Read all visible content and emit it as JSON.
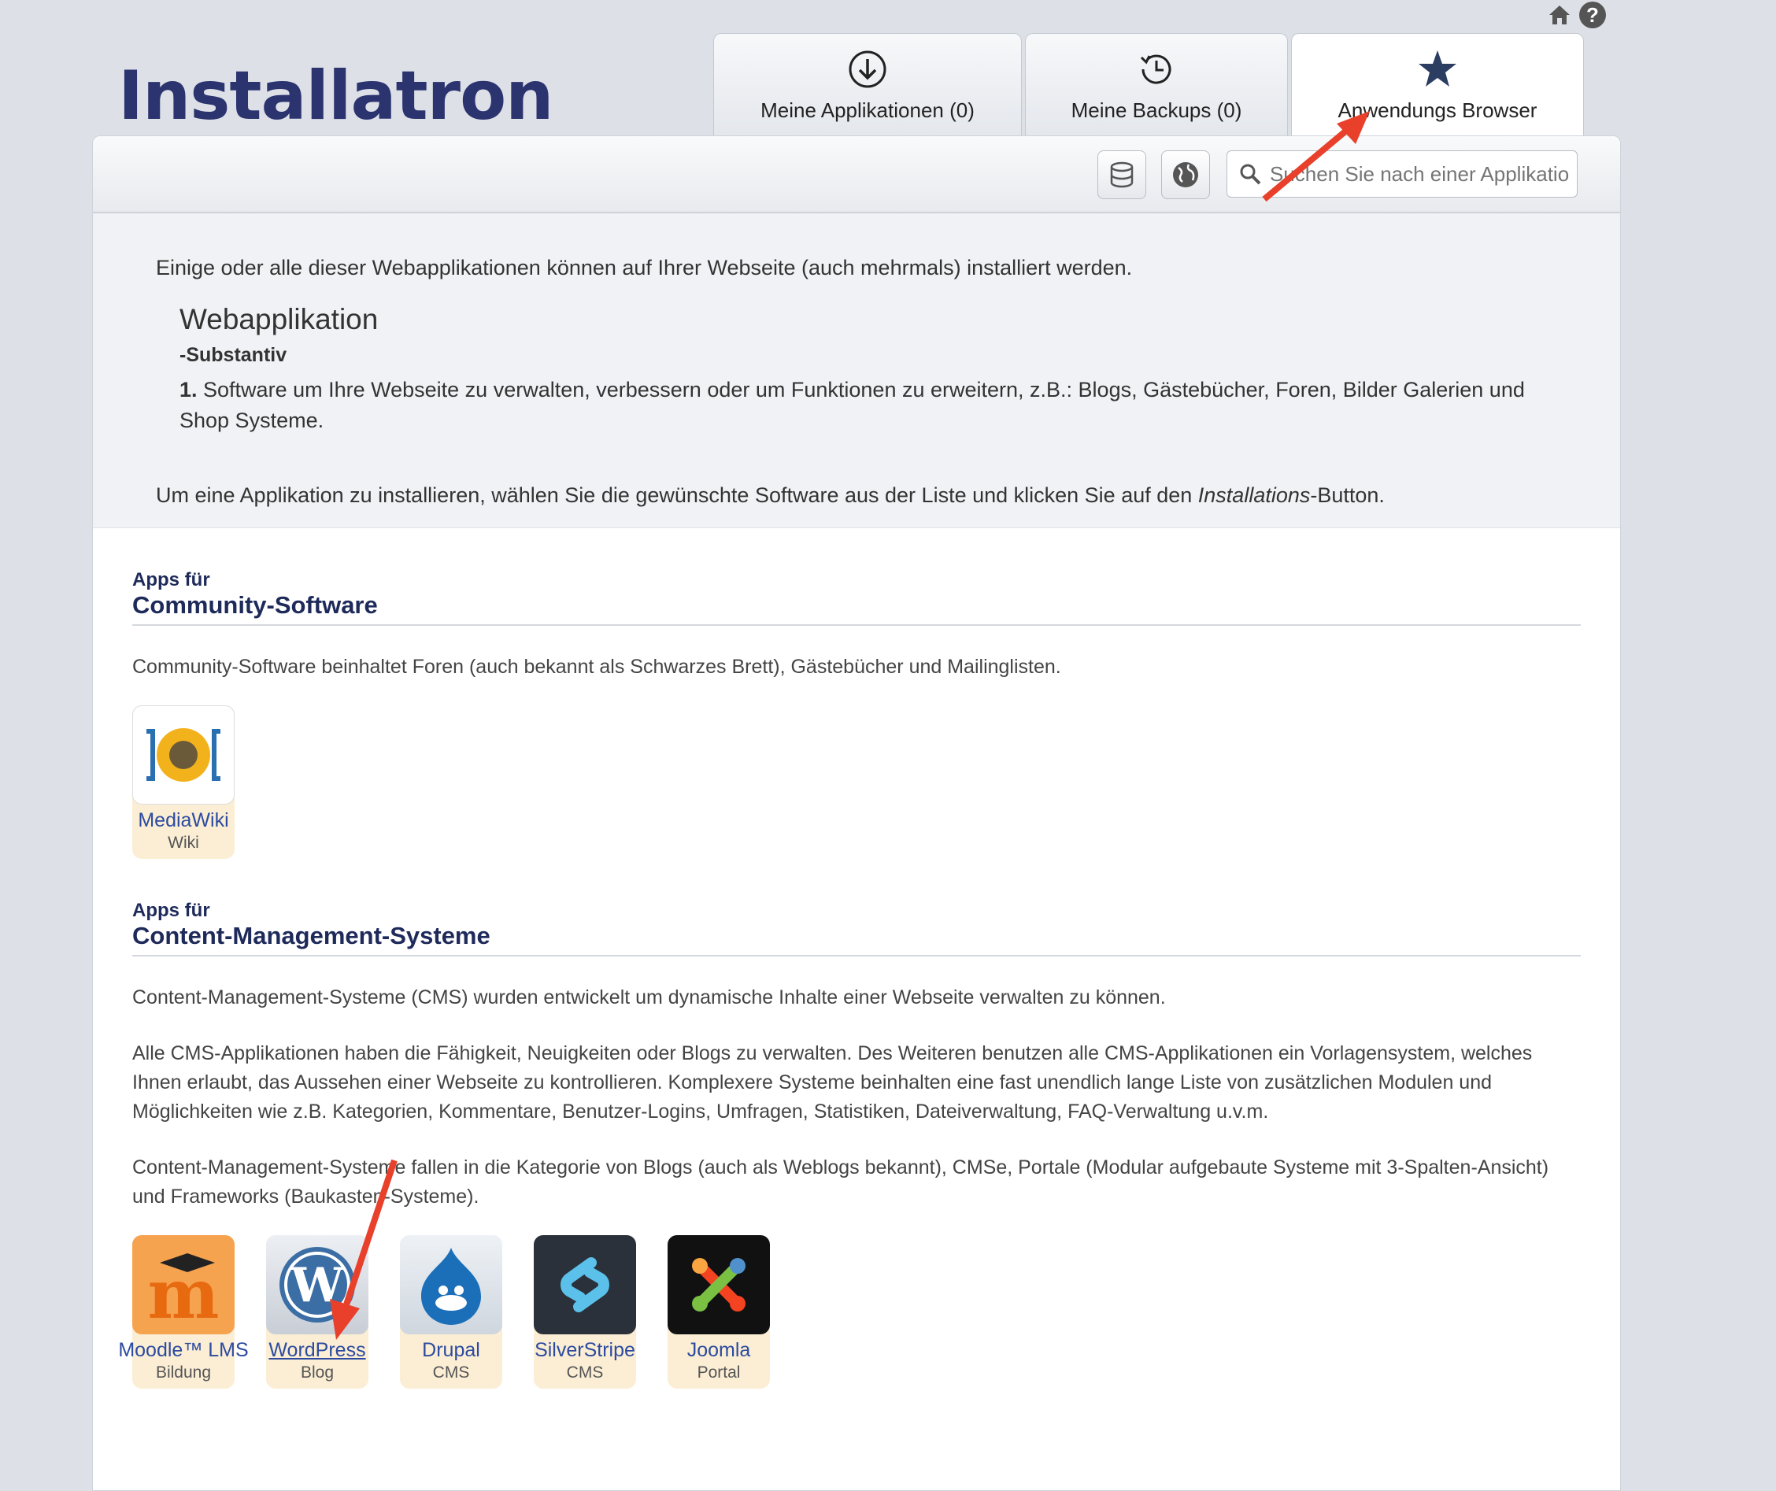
{
  "logo": {
    "text": "Installatron"
  },
  "tabs": [
    {
      "label": "Meine Applikationen (0)"
    },
    {
      "label": "Meine Backups (0)"
    },
    {
      "label": "Anwendungs Browser"
    }
  ],
  "search": {
    "placeholder": "Suchen Sie nach einer Applikation"
  },
  "intro": {
    "line1": "Einige oder alle dieser Webapplikationen können auf Ihrer Webseite (auch mehrmals) installiert werden.",
    "word": "Webapplikation",
    "pos": "-Substantiv",
    "num": "1.",
    "meaning": " Software um Ihre Webseite zu verwalten, verbessern oder um Funktionen zu erweitern, z.B.: Blogs, Gästebücher, Foren, Bilder Galerien und Shop Systeme.",
    "howto_a": "Um eine Applikation zu installieren, wählen Sie die gewünschte Software aus der Liste und klicken Sie auf den ",
    "howto_em": "Installations",
    "howto_b": "-Button."
  },
  "community": {
    "pre": "Apps für",
    "title": "Community-Software",
    "text": "Community-Software beinhaltet Foren (auch bekannt als Schwarzes Brett), Gästebücher und Mailinglisten.",
    "apps": [
      {
        "name": "MediaWiki",
        "category": "Wiki"
      }
    ]
  },
  "cms": {
    "pre": "Apps für",
    "title": "Content-Management-Systeme",
    "text1": "Content-Management-Systeme (CMS) wurden entwickelt um dynamische Inhalte einer Webseite verwalten zu können.",
    "text2": "Alle CMS-Applikationen haben die Fähigkeit, Neuigkeiten oder Blogs zu verwalten. Des Weiteren benutzen alle CMS-Applikationen ein Vorlagensystem, welches Ihnen erlaubt, das Aussehen einer Webseite zu kontrollieren. Komplexere Systeme beinhalten eine fast unendlich lange Liste von zusätzlichen Modulen und Möglichkeiten wie z.B. Kategorien, Kommentare, Benutzer-Logins, Umfragen, Statistiken, Dateiverwaltung, FAQ-Verwaltung u.v.m.",
    "text3": "Content-Management-Systeme fallen in die Kategorie von Blogs (auch als Weblogs bekannt), CMSe, Portale (Modular aufgebaute Systeme mit 3-Spalten-Ansicht) und Frameworks (Baukasten-Systeme).",
    "apps": [
      {
        "name": "Moodle™ LMS",
        "category": "Bildung"
      },
      {
        "name": "WordPress",
        "category": "Blog"
      },
      {
        "name": "Drupal",
        "category": "CMS"
      },
      {
        "name": "SilverStripe",
        "category": "CMS"
      },
      {
        "name": "Joomla",
        "category": "Portal"
      }
    ]
  },
  "icons": [
    "home-icon",
    "help-icon",
    "download-icon",
    "history-icon",
    "star-icon",
    "database-icon",
    "globe-icon",
    "search-icon"
  ],
  "colors": {
    "heading": "#1e2a5a",
    "link": "#2c4ba0",
    "app_bg": "#fbeed4",
    "arrow": "#e8402a"
  }
}
